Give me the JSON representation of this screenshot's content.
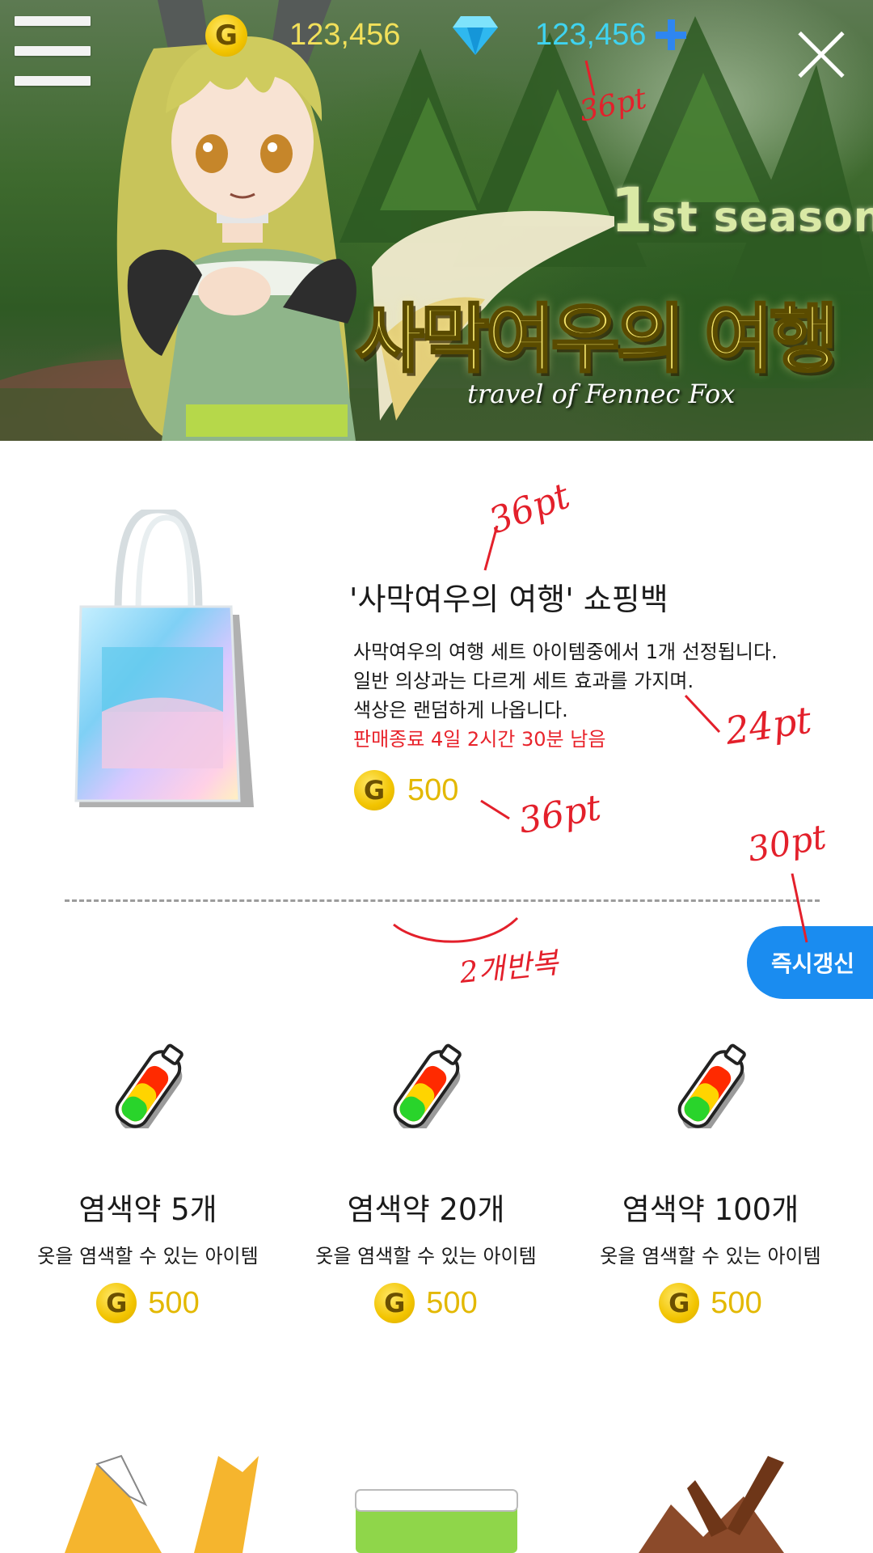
{
  "hud": {
    "gold_icon": "G",
    "gold_value": "123,456",
    "gem_value": "123,456"
  },
  "banner": {
    "season_number": "1",
    "season_word": "st season",
    "title": "사막여우의 여행",
    "subtitle": "travel of Fennec Fox"
  },
  "featured": {
    "name": "'사막여우의 여행' 쇼핑백",
    "description_lines": [
      "사막여우의 여행 세트 아이템중에서 1개 선정됩니다.",
      "일반 의상과는 다르게 세트 효과를 가지며.",
      "색상은 랜덤하게 나옵니다."
    ],
    "deadline": "판매종료 4일 2시간 30분 남음",
    "currency_icon": "G",
    "price": "500"
  },
  "refresh_button": "즉시갱신",
  "items": [
    {
      "name": "염색약 5개",
      "desc": "옷을 염색할 수 있는 아이템",
      "currency_icon": "G",
      "price": "500"
    },
    {
      "name": "염색약 20개",
      "desc": "옷을 염색할 수 있는 아이템",
      "currency_icon": "G",
      "price": "500"
    },
    {
      "name": "염색약 100개",
      "desc": "옷을 염색할 수 있는 아이템",
      "currency_icon": "G",
      "price": "500"
    }
  ],
  "annotations": {
    "hud_size": "36pt",
    "name_size": "36pt",
    "desc_size": "24pt",
    "price_size": "36pt",
    "button_size": "30pt",
    "repeat_note": "2개반복"
  },
  "colors": {
    "gold": "#e3b800",
    "gem_text": "#3fd3f0",
    "deadline": "#e8232b",
    "button": "#1a8cf0",
    "annotation": "#e3202b"
  },
  "icons": [
    "menu-icon",
    "gold-coin-icon",
    "gem-icon",
    "plus-icon",
    "close-icon",
    "shopping-bag-image",
    "dye-bottle-icon"
  ]
}
